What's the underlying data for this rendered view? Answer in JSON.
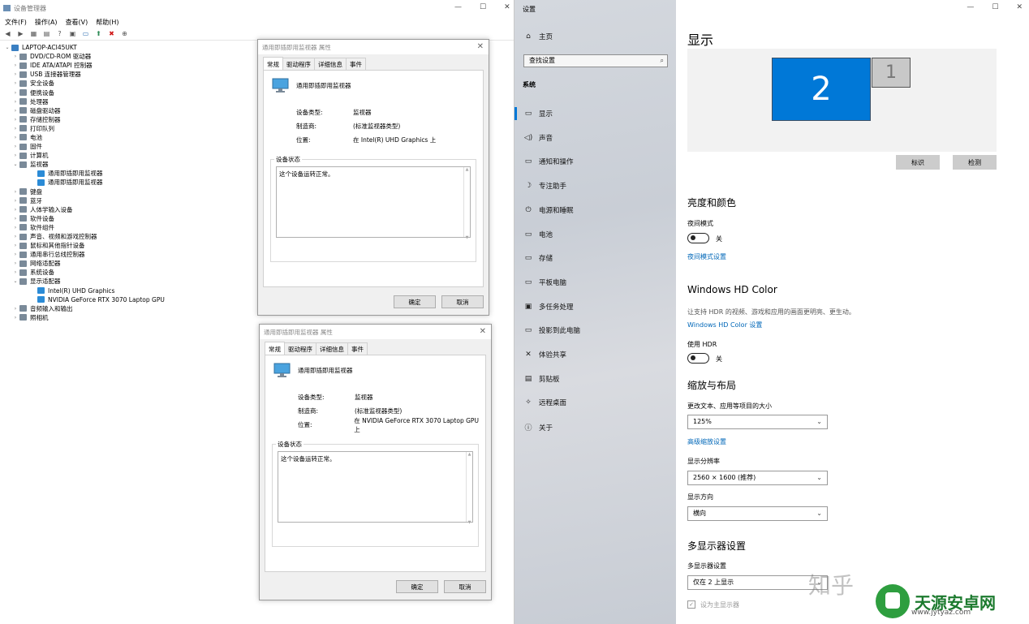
{
  "devmgr": {
    "title": "设备管理器",
    "menu": [
      "文件(F)",
      "操作(A)",
      "查看(V)",
      "帮助(H)"
    ],
    "root": "LAPTOP-ACI45UKT",
    "tree": [
      {
        "label": "DVD/CD-ROM 驱动器",
        "level": 0,
        "arrow": "›"
      },
      {
        "label": "IDE ATA/ATAPI 控制器",
        "level": 0,
        "arrow": "›"
      },
      {
        "label": "USB 连接器管理器",
        "level": 0,
        "arrow": "›"
      },
      {
        "label": "安全设备",
        "level": 0,
        "arrow": "›"
      },
      {
        "label": "便携设备",
        "level": 0,
        "arrow": "›"
      },
      {
        "label": "处理器",
        "level": 0,
        "arrow": "›"
      },
      {
        "label": "磁盘驱动器",
        "level": 0,
        "arrow": "›"
      },
      {
        "label": "存储控制器",
        "level": 0,
        "arrow": "›"
      },
      {
        "label": "打印队列",
        "level": 0,
        "arrow": "›"
      },
      {
        "label": "电池",
        "level": 0,
        "arrow": "›"
      },
      {
        "label": "固件",
        "level": 0,
        "arrow": "›"
      },
      {
        "label": "计算机",
        "level": 0,
        "arrow": "›"
      },
      {
        "label": "监视器",
        "level": 0,
        "arrow": "⌄"
      },
      {
        "label": "通用即插即用监视器",
        "level": 1,
        "arrow": ""
      },
      {
        "label": "通用即插即用监视器",
        "level": 1,
        "arrow": ""
      },
      {
        "label": "键盘",
        "level": 0,
        "arrow": "›"
      },
      {
        "label": "蓝牙",
        "level": 0,
        "arrow": "›"
      },
      {
        "label": "人体学输入设备",
        "level": 0,
        "arrow": "›"
      },
      {
        "label": "软件设备",
        "level": 0,
        "arrow": "›"
      },
      {
        "label": "软件组件",
        "level": 0,
        "arrow": "›"
      },
      {
        "label": "声音、视频和游戏控制器",
        "level": 0,
        "arrow": "›"
      },
      {
        "label": "鼠标和其他指针设备",
        "level": 0,
        "arrow": "›"
      },
      {
        "label": "通用串行总线控制器",
        "level": 0,
        "arrow": "›"
      },
      {
        "label": "网络适配器",
        "level": 0,
        "arrow": "›"
      },
      {
        "label": "系统设备",
        "level": 0,
        "arrow": "›"
      },
      {
        "label": "显示适配器",
        "level": 0,
        "arrow": "⌄"
      },
      {
        "label": "Intel(R) UHD Graphics",
        "level": 1,
        "arrow": ""
      },
      {
        "label": "NVIDIA GeForce RTX 3070 Laptop GPU",
        "level": 1,
        "arrow": ""
      },
      {
        "label": "音频输入和输出",
        "level": 0,
        "arrow": "›"
      },
      {
        "label": "照相机",
        "level": 0,
        "arrow": "›"
      }
    ]
  },
  "dialog1": {
    "title": "通用即插即用监视器 属性",
    "tabs": [
      "常规",
      "驱动程序",
      "详细信息",
      "事件"
    ],
    "device_name": "通用即插即用监视器",
    "type_label": "设备类型:",
    "type_value": "监视器",
    "mfr_label": "制造商:",
    "mfr_value": "(标准监视器类型)",
    "loc_label": "位置:",
    "loc_value": "在 Intel(R) UHD Graphics 上",
    "status_group": "设备状态",
    "status_text": "这个设备运转正常。",
    "ok": "确定",
    "cancel": "取消"
  },
  "dialog2": {
    "title": "通用即插即用监视器 属性",
    "tabs": [
      "常规",
      "驱动程序",
      "详细信息",
      "事件"
    ],
    "device_name": "通用即插即用监视器",
    "type_label": "设备类型:",
    "type_value": "监视器",
    "mfr_label": "制造商:",
    "mfr_value": "(标准监视器类型)",
    "loc_label": "位置:",
    "loc_value": "在 NVIDIA GeForce RTX 3070 Laptop GPU 上",
    "status_group": "设备状态",
    "status_text": "这个设备运转正常。",
    "ok": "确定",
    "cancel": "取消"
  },
  "settings": {
    "app_title": "设置",
    "home": "主页",
    "search_placeholder": "查找设置",
    "section": "系统",
    "nav": [
      "显示",
      "声音",
      "通知和操作",
      "专注助手",
      "电源和睡眠",
      "电池",
      "存储",
      "平板电脑",
      "多任务处理",
      "投影到此电脑",
      "体验共享",
      "剪贴板",
      "远程桌面",
      "关于"
    ],
    "page_title": "显示",
    "monitor_main": "2",
    "monitor_secondary": "1",
    "identify": "标识",
    "detect": "检测",
    "brightness_header": "亮度和颜色",
    "night_light_label": "夜间模式",
    "night_light_state": "关",
    "night_light_link": "夜间模式设置",
    "hdr_header": "Windows HD Color",
    "hdr_desc": "让支持 HDR 的视频、游戏和应用的画面更明亮、更生动。",
    "hdr_link": "Windows HD Color 设置",
    "hdr_use_label": "使用 HDR",
    "hdr_state": "关",
    "scale_header": "缩放与布局",
    "scale_label": "更改文本、应用等项目的大小",
    "scale_value": "125%",
    "adv_scale_link": "高级缩放设置",
    "resolution_label": "显示分辨率",
    "resolution_value": "2560 × 1600 (推荐)",
    "orientation_label": "显示方向",
    "orientation_value": "横向",
    "multi_header": "多显示器设置",
    "multi_label": "多显示器设置",
    "multi_value": "仅在 2 上显示",
    "main_display_check": "设为主显示器"
  },
  "watermark": {
    "zhihu": "知乎",
    "site_name": "天源安卓网",
    "site_url": "www.jytyaz.com"
  }
}
